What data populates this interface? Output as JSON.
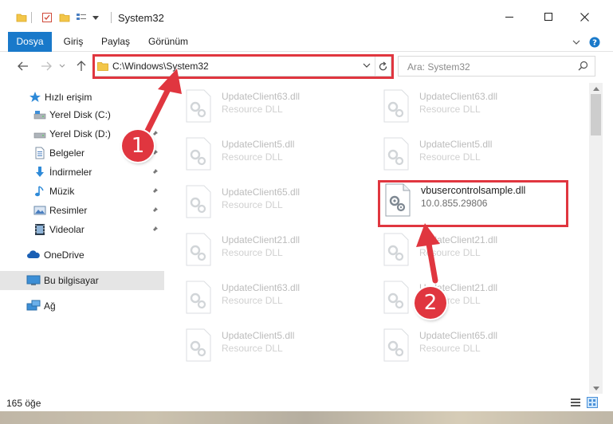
{
  "window": {
    "title": "System32",
    "minimize_label": "—",
    "maximize_label": "☐",
    "close_label": "✕"
  },
  "ribbon": {
    "tabs": [
      {
        "label": "Dosya"
      },
      {
        "label": "Giriş"
      },
      {
        "label": "Paylaş"
      },
      {
        "label": "Görünüm"
      }
    ],
    "expand_label": "⌄",
    "help_label": "?"
  },
  "address": {
    "path": "C:\\Windows\\System32",
    "search_placeholder": "Ara: System32"
  },
  "sidebar": {
    "items": [
      {
        "label": "Hızlı erişim",
        "icon": "star-icon"
      },
      {
        "label": "Yerel Disk (C:)",
        "icon": "drive-icon",
        "pinned": true
      },
      {
        "label": "Yerel Disk (D:)",
        "icon": "drive-icon",
        "pinned": true
      },
      {
        "label": "Belgeler",
        "icon": "documents-icon",
        "pinned": true
      },
      {
        "label": "İndirmeler",
        "icon": "download-icon",
        "pinned": true
      },
      {
        "label": "Müzik",
        "icon": "music-icon",
        "pinned": true
      },
      {
        "label": "Resimler",
        "icon": "pictures-icon",
        "pinned": true
      },
      {
        "label": "Videolar",
        "icon": "videos-icon",
        "pinned": true
      },
      {
        "label": "OneDrive",
        "icon": "cloud-icon"
      },
      {
        "label": "Bu bilgisayar",
        "icon": "computer-icon",
        "selected": true
      },
      {
        "label": "Ağ",
        "icon": "network-icon"
      }
    ]
  },
  "files": {
    "left": [
      {
        "name": "UpdateClient63.dll",
        "type": "Resource DLL"
      },
      {
        "name": "UpdateClient5.dll",
        "type": "Resource DLL"
      },
      {
        "name": "UpdateClient65.dll",
        "type": "Resource DLL"
      },
      {
        "name": "UpdateClient21.dll",
        "type": "Resource DLL"
      },
      {
        "name": "UpdateClient63.dll",
        "type": "Resource DLL"
      },
      {
        "name": "UpdateClient5.dll",
        "type": "Resource DLL"
      }
    ],
    "right": [
      {
        "name": "UpdateClient63.dll",
        "type": "Resource DLL"
      },
      {
        "name": "UpdateClient5.dll",
        "type": "Resource DLL"
      },
      {
        "name": "vbusercontrolsample.dll",
        "type": "10.0.855.29806",
        "highlight": true
      },
      {
        "name": "UpdateClient21.dll",
        "type": "Resource DLL"
      },
      {
        "name": "UpdateClient21.dll",
        "type": "Resource DLL"
      },
      {
        "name": "UpdateClient65.dll",
        "type": "Resource DLL"
      }
    ]
  },
  "status": {
    "item_count": "165 öğe"
  },
  "annotations": {
    "badge1": "1",
    "badge2": "2",
    "accent_color": "#e0363f"
  },
  "colors": {
    "ribbon_file_tab": "#1979ca",
    "selection": "#e5e5e5"
  }
}
